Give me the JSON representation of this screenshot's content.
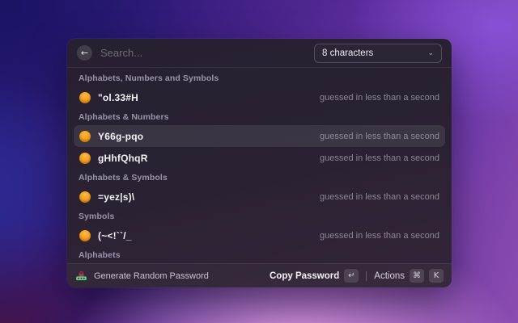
{
  "header": {
    "back_icon": "←",
    "search_placeholder": "Search...",
    "dropdown": {
      "value": "8 characters",
      "chevron_icon": "⌄"
    }
  },
  "list": {
    "strength_text": "guessed in less than a second",
    "sections": [
      {
        "label": "Alphabets, Numbers and Symbols",
        "items": [
          {
            "password": "\"ol.33#H",
            "strength": "guessed in less than a second",
            "selected": false
          }
        ]
      },
      {
        "label": "Alphabets & Numbers",
        "items": [
          {
            "password": "Y66g-pqo",
            "strength": "guessed in less than a second",
            "selected": true
          },
          {
            "password": "gHhfQhqR",
            "strength": "guessed in less than a second",
            "selected": false
          }
        ]
      },
      {
        "label": "Alphabets & Symbols",
        "items": [
          {
            "password": "=yez|s)\\",
            "strength": "guessed in less than a second",
            "selected": false
          }
        ]
      },
      {
        "label": "Symbols",
        "items": [
          {
            "password": "(~<!``/_",
            "strength": "guessed in less than a second",
            "selected": false
          }
        ]
      },
      {
        "label": "Alphabets",
        "items": []
      }
    ]
  },
  "footer": {
    "title": "Generate Random Password",
    "primary_action": "Copy Password",
    "primary_key": "↵",
    "secondary_action": "Actions",
    "secondary_keys": [
      "⌘",
      "K"
    ]
  },
  "colors": {
    "accent_orange": "#f6a01e",
    "panel_bg": "#2a2233",
    "selected_row": "rgba(255,255,255,0.085)",
    "icon_lock_red": "#a03a4a",
    "icon_bar_green": "#6fcf8e"
  }
}
